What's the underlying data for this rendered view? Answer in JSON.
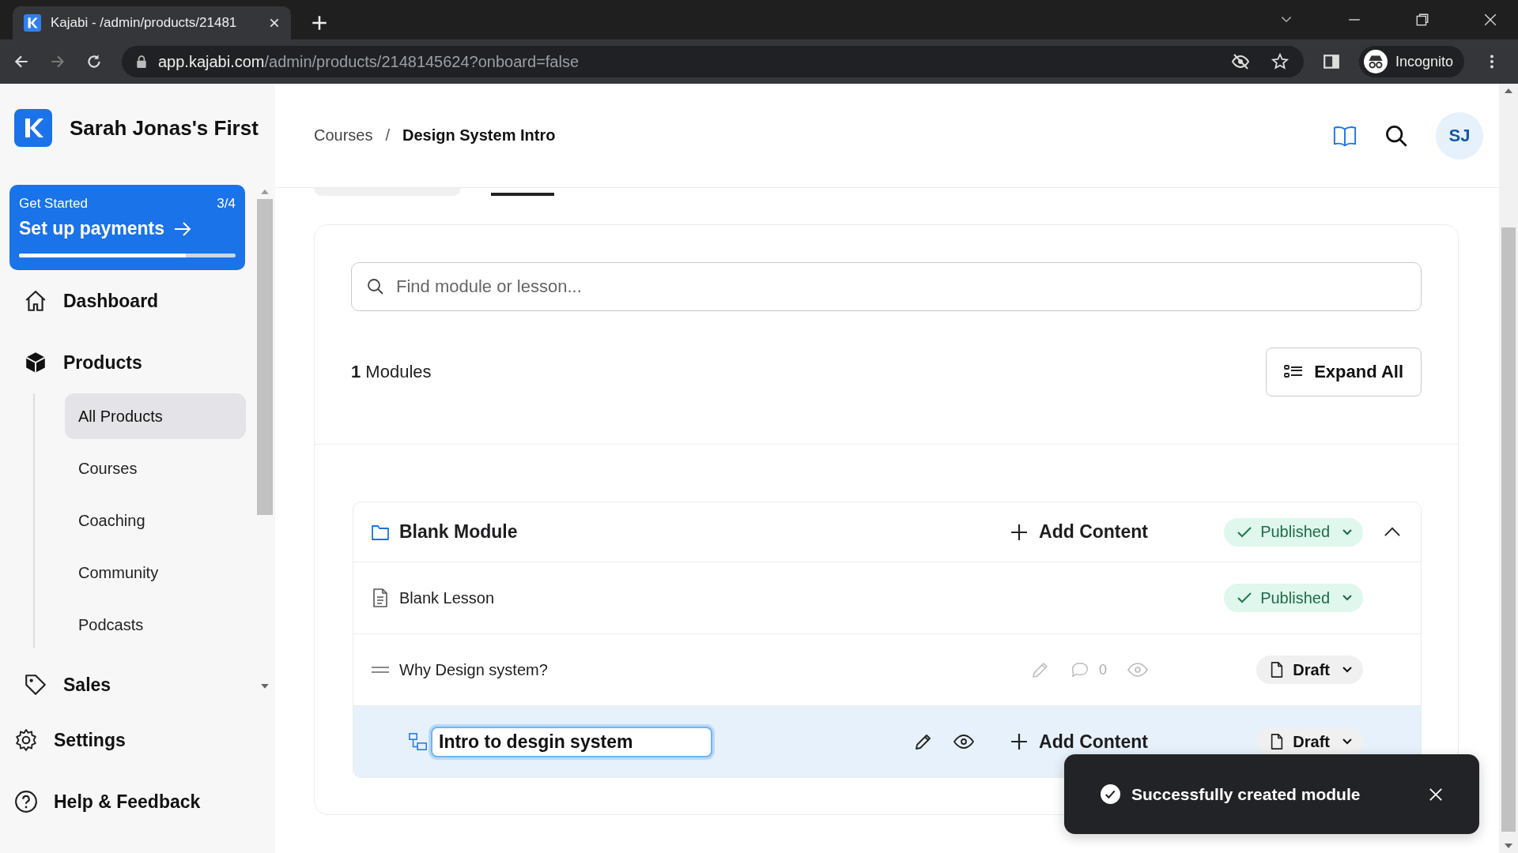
{
  "browser": {
    "tab_title": "Kajabi - /admin/products/21481",
    "url_host": "app.kajabi.com",
    "url_path": "/admin/products/2148145624?onboard=false",
    "profile": "Incognito"
  },
  "sidebar": {
    "brand": "Sarah Jonas's First",
    "get_started": {
      "label": "Get Started",
      "count": "3/4",
      "title": "Set up payments",
      "level": 0.77
    },
    "items": [
      {
        "label": "Dashboard",
        "selected": false
      },
      {
        "label": "Products",
        "selected": false,
        "expanded": true,
        "children": [
          {
            "label": "All Products",
            "selected": true
          },
          {
            "label": "Courses",
            "selected": false
          },
          {
            "label": "Coaching",
            "selected": false
          },
          {
            "label": "Community",
            "selected": false
          },
          {
            "label": "Podcasts",
            "selected": false
          }
        ]
      },
      {
        "label": "Sales",
        "selected": false
      }
    ],
    "bottom_items": [
      {
        "label": "Settings"
      },
      {
        "label": "Help & Feedback"
      }
    ]
  },
  "header": {
    "breadcrumb": [
      "Courses",
      "Design System Intro"
    ],
    "separator": "/",
    "avatar": "SJ"
  },
  "content": {
    "search": {
      "placeholder": "Find module or lesson..."
    },
    "modules_count": "**1** Modules",
    "expand_all": "Expand All",
    "module": {
      "title": "Blank Module",
      "add_content": "Add Content",
      "status": {
        "label": "Published",
        "published": true
      },
      "expanded": true,
      "rows": [
        {
          "kind": "lesson",
          "title": "Blank Lesson",
          "status": {
            "label": "Published",
            "published": true
          },
          "selected": false
        },
        {
          "kind": "draggable",
          "title": "Why Design system?",
          "comments": "0",
          "status": {
            "label": "Draft",
            "published": false
          },
          "selected": false
        },
        {
          "kind": "submodule",
          "title": "Intro to desgin system",
          "add_content": "Add Content",
          "status": {
            "label": "Draft",
            "published": false
          },
          "selected": true
        }
      ]
    }
  },
  "toast": {
    "message": "Successfully created module"
  }
}
